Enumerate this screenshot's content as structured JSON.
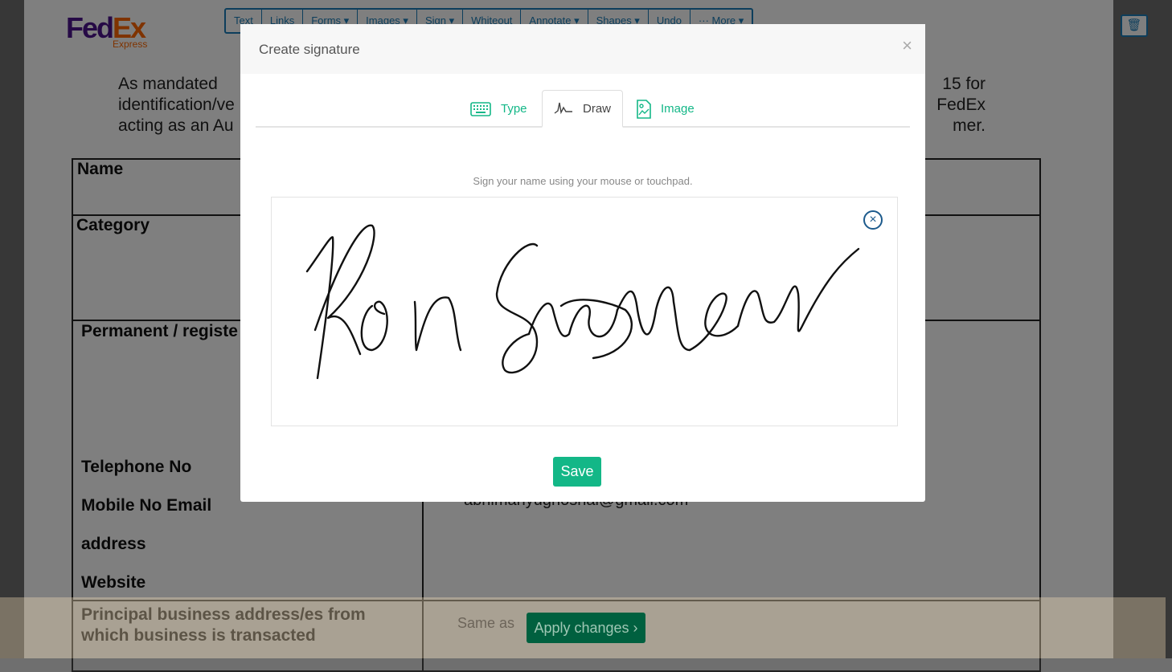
{
  "toolbar": {
    "items": [
      "Text",
      "Links",
      "Forms ▾",
      "Images ▾",
      "Sign ▾",
      "Whiteout",
      "Annotate ▾",
      "Shapes ▾",
      "Undo",
      "··· More ▾"
    ]
  },
  "document": {
    "logo": "FedEx Express",
    "para_left": [
      "As  mandated",
      "identification/ve",
      "acting as an Au"
    ],
    "para_right": [
      "15  for",
      "FedEx",
      "mer."
    ],
    "labels": {
      "name": "Name",
      "category": "Category",
      "permanent": "Permanent / registe",
      "telephone": "Telephone No",
      "mobile": "Mobile No Email",
      "address": "address",
      "website": "Website",
      "principal": "Principal business address/es from which business is transacted"
    },
    "email_value": "abhimanyughoshal@gmail.com",
    "same_as": "Same as"
  },
  "apply_button": "Apply changes ›",
  "modal": {
    "title": "Create signature",
    "close": "×",
    "tabs": [
      {
        "label": "Type",
        "icon": "keyboard-icon"
      },
      {
        "label": "Draw",
        "icon": "signature-wave-icon",
        "active": true
      },
      {
        "label": "Image",
        "icon": "image-file-icon"
      }
    ],
    "hint": "Sign your name using your mouse or touchpad.",
    "clear": "×",
    "save": "Save"
  },
  "colors": {
    "accent": "#13b787",
    "toolbar": "#1b7db8",
    "apply": "#00603f"
  }
}
